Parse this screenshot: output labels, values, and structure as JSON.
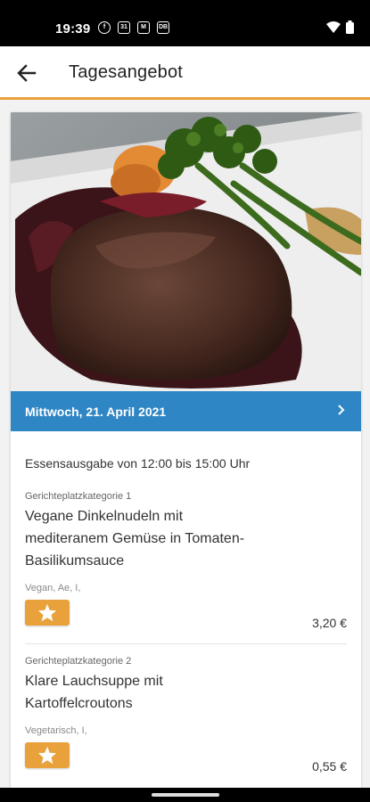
{
  "status_bar": {
    "time": "19:39",
    "icons": [
      "flipboard-icon",
      "calendar-31-icon",
      "gmail-icon",
      "db-icon"
    ],
    "calendar_text": "31",
    "db_text": "DB"
  },
  "app_bar": {
    "title": "Tagesangebot"
  },
  "offer": {
    "date": "Mittwoch, 21. April 2021",
    "hours": "Essensausgabe von 12:00 bis 15:00 Uhr",
    "dishes": [
      {
        "category": "Gerichteplatzkategorie 1",
        "name_lines": [
          "Vegane Dinkelnudeln mit",
          "mediteranem Gemüse in Tomaten-",
          "Basilikumsauce"
        ],
        "tags": "Vegan, Ae, I,",
        "price": "3,20 €"
      },
      {
        "category": "Gerichteplatzkategorie 2",
        "name_lines": [
          "Klare Lauchsuppe mit",
          "Kartoffelcroutons"
        ],
        "tags": "Vegetarisch, I,",
        "price": "0,55 €"
      }
    ]
  },
  "colors": {
    "accent": "#e9a23b",
    "date_bar": "#2f86c5"
  }
}
